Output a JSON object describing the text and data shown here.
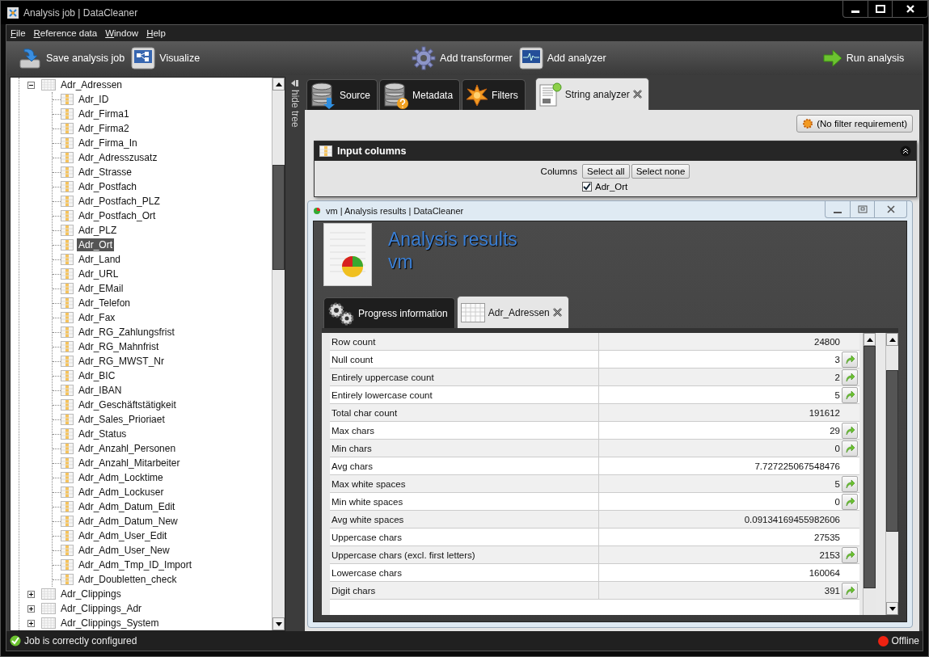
{
  "window": {
    "title": "Analysis job | DataCleaner"
  },
  "menu": [
    {
      "label": "File"
    },
    {
      "label": "Reference data"
    },
    {
      "label": "Window"
    },
    {
      "label": "Help"
    }
  ],
  "toolbar": [
    {
      "label": "Save analysis job",
      "kind": "save"
    },
    {
      "label": "Visualize",
      "kind": "visualize"
    },
    {
      "label": "Add transformer",
      "kind": "transformer"
    },
    {
      "label": "Add analyzer",
      "kind": "analyzer"
    },
    {
      "label": "Run analysis",
      "kind": "run"
    }
  ],
  "tree": {
    "items": [
      {
        "label": "Adr_Adressen",
        "expanded": true,
        "children": [
          {
            "label": "Adr_ID",
            "selected": false
          },
          {
            "label": "Adr_Firma1",
            "selected": false
          },
          {
            "label": "Adr_Firma2",
            "selected": false
          },
          {
            "label": "Adr_Firma_In",
            "selected": false
          },
          {
            "label": "Adr_Adresszusatz",
            "selected": false
          },
          {
            "label": "Adr_Strasse",
            "selected": false
          },
          {
            "label": "Adr_Postfach",
            "selected": false
          },
          {
            "label": "Adr_Postfach_PLZ",
            "selected": false
          },
          {
            "label": "Adr_Postfach_Ort",
            "selected": false
          },
          {
            "label": "Adr_PLZ",
            "selected": false
          },
          {
            "label": "Adr_Ort",
            "selected": true
          },
          {
            "label": "Adr_Land",
            "selected": false
          },
          {
            "label": "Adr_URL",
            "selected": false
          },
          {
            "label": "Adr_EMail",
            "selected": false
          },
          {
            "label": "Adr_Telefon",
            "selected": false
          },
          {
            "label": "Adr_Fax",
            "selected": false
          },
          {
            "label": "Adr_RG_Zahlungsfrist",
            "selected": false
          },
          {
            "label": "Adr_RG_Mahnfrist",
            "selected": false
          },
          {
            "label": "Adr_RG_MWST_Nr",
            "selected": false
          },
          {
            "label": "Adr_BIC",
            "selected": false
          },
          {
            "label": "Adr_IBAN",
            "selected": false
          },
          {
            "label": "Adr_Geschäftstätigkeit",
            "selected": false
          },
          {
            "label": "Adr_Sales_Prioriaet",
            "selected": false
          },
          {
            "label": "Adr_Status",
            "selected": false
          },
          {
            "label": "Adr_Anzahl_Personen",
            "selected": false
          },
          {
            "label": "Adr_Anzahl_Mitarbeiter",
            "selected": false
          },
          {
            "label": "Adr_Adm_Locktime",
            "selected": false
          },
          {
            "label": "Adr_Adm_Lockuser",
            "selected": false
          },
          {
            "label": "Adr_Adm_Datum_Edit",
            "selected": false
          },
          {
            "label": "Adr_Adm_Datum_New",
            "selected": false
          },
          {
            "label": "Adr_Adm_User_Edit",
            "selected": false
          },
          {
            "label": "Adr_Adm_User_New",
            "selected": false
          },
          {
            "label": "Adr_Adm_Tmp_ID_Import",
            "selected": false
          },
          {
            "label": "Adr_Doubletten_check",
            "selected": false
          }
        ]
      },
      {
        "label": "Adr_Clippings",
        "expanded": false
      },
      {
        "label": "Adr_Clippings_Adr",
        "expanded": false
      },
      {
        "label": "Adr_Clippings_System",
        "expanded": false
      }
    ]
  },
  "hide_tree": "hide tree",
  "tabs": [
    {
      "label": "Source",
      "kind": "source",
      "selected": false,
      "closable": false
    },
    {
      "label": "Metadata",
      "kind": "metadata",
      "selected": false,
      "closable": false
    },
    {
      "label": "Filters",
      "kind": "filters",
      "selected": false,
      "closable": false
    },
    {
      "label": "String analyzer",
      "kind": "analyzer",
      "selected": true,
      "closable": true
    }
  ],
  "filter_button": "(No filter requirement)",
  "input_columns": {
    "title": "Input columns",
    "columns_label": "Columns",
    "buttons": [
      "Select all",
      "Select none"
    ],
    "checkboxes": [
      {
        "label": "Adr_Ort",
        "checked": true
      }
    ]
  },
  "results_window": {
    "title": "vm | Analysis results | DataCleaner",
    "heading": "Analysis results",
    "subheading": "vm",
    "tabs": [
      {
        "label": "Progress information",
        "kind": "progress",
        "selected": false,
        "closable": false
      },
      {
        "label": "Adr_Adressen",
        "kind": "table",
        "selected": true,
        "closable": true
      }
    ],
    "rows": [
      {
        "label": "Row count",
        "value": "24800",
        "details": false
      },
      {
        "label": "Null count",
        "value": "3",
        "details": true
      },
      {
        "label": "Entirely uppercase count",
        "value": "2",
        "details": true
      },
      {
        "label": "Entirely lowercase count",
        "value": "5",
        "details": true
      },
      {
        "label": "Total char count",
        "value": "191612",
        "details": false
      },
      {
        "label": "Max chars",
        "value": "29",
        "details": true
      },
      {
        "label": "Min chars",
        "value": "0",
        "details": true
      },
      {
        "label": "Avg chars",
        "value": "7.727225067548476",
        "details": false
      },
      {
        "label": "Max white spaces",
        "value": "5",
        "details": true
      },
      {
        "label": "Min white spaces",
        "value": "0",
        "details": true
      },
      {
        "label": "Avg white spaces",
        "value": "0.09134169455982606",
        "details": false
      },
      {
        "label": "Uppercase chars",
        "value": "27535",
        "details": false
      },
      {
        "label": "Uppercase chars (excl. first letters)",
        "value": "2153",
        "details": true
      },
      {
        "label": "Lowercase chars",
        "value": "160064",
        "details": false
      },
      {
        "label": "Digit chars",
        "value": "391",
        "details": true
      }
    ]
  },
  "status": {
    "message": "Job is correctly configured",
    "connection": "Offline",
    "online": false
  }
}
